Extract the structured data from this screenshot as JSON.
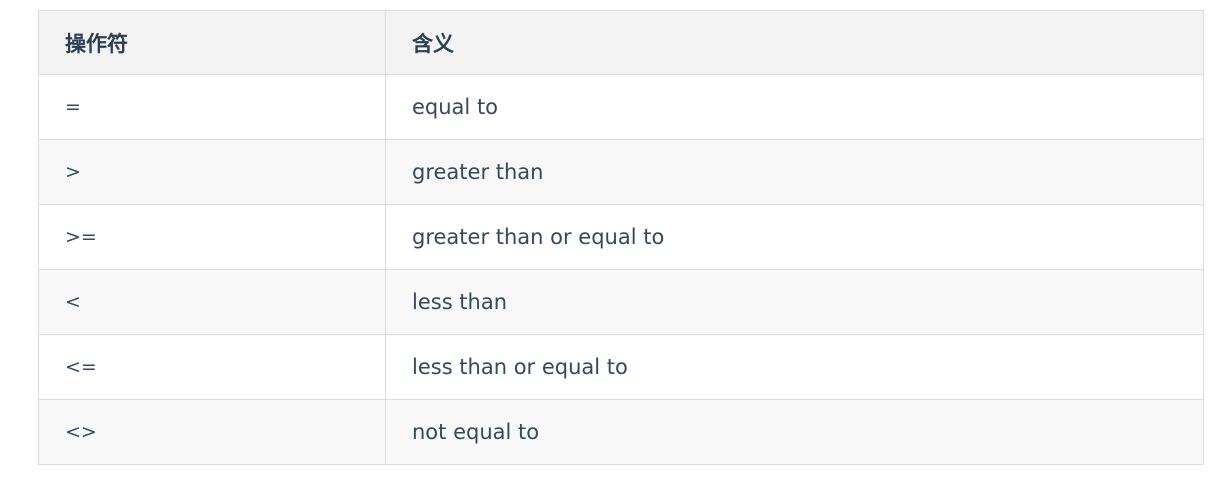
{
  "table": {
    "headers": {
      "operator": "操作符",
      "meaning": "含义"
    },
    "rows": [
      {
        "operator": "=",
        "meaning": "equal to"
      },
      {
        "operator": ">",
        "meaning": "greater than"
      },
      {
        "operator": ">=",
        "meaning": "greater than or equal to"
      },
      {
        "operator": "<",
        "meaning": "less than"
      },
      {
        "operator": "<=",
        "meaning": "less than or equal to"
      },
      {
        "operator": "<>",
        "meaning": "not equal to"
      }
    ]
  },
  "colors": {
    "header_bg": "#f3f3f3",
    "row_alt_bg": "#f8f8f8",
    "border": "#dcdcdc",
    "text": "#34495e"
  }
}
